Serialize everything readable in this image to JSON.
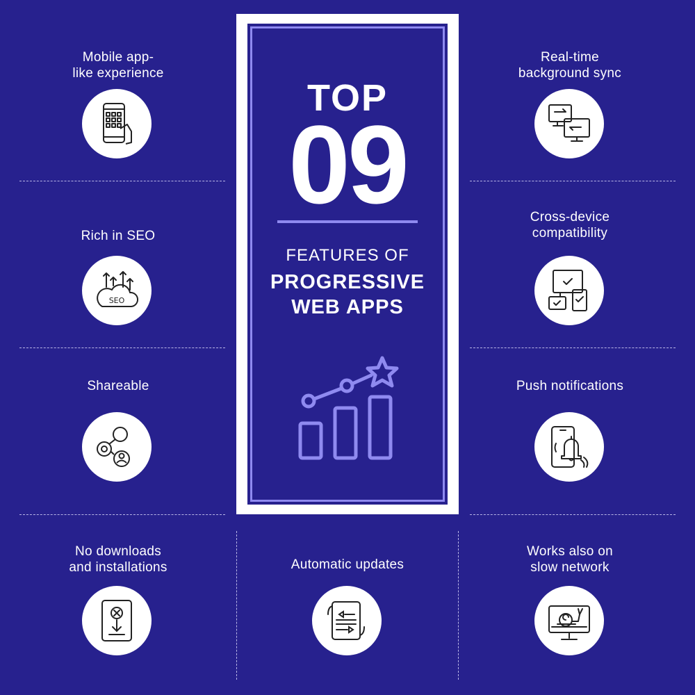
{
  "panel": {
    "top": "TOP",
    "number": "09",
    "line1": "FEATURES OF",
    "line2": "PROGRESSIVE\nWEB APPS",
    "icon": "growth-chart-star-icon"
  },
  "features": {
    "mobile": {
      "label": "Mobile app-\nlike experience",
      "icon": "mobile-touch-icon"
    },
    "seo": {
      "label": "Rich in SEO",
      "icon": "seo-cloud-icon"
    },
    "share": {
      "label": "Shareable",
      "icon": "share-users-icon"
    },
    "nodownload": {
      "label": "No downloads\nand installations",
      "icon": "no-download-icon"
    },
    "updates": {
      "label": "Automatic updates",
      "icon": "auto-update-icon"
    },
    "sync": {
      "label": "Real-time\nbackground sync",
      "icon": "sync-monitors-icon"
    },
    "crossdevice": {
      "label": "Cross-device\ncompatibility",
      "icon": "devices-check-icon"
    },
    "push": {
      "label": "Push notifications",
      "icon": "phone-bell-icon"
    },
    "slow": {
      "label": "Works also on\nslow network",
      "icon": "snail-monitor-icon"
    }
  },
  "colors": {
    "background": "#27218e",
    "accent": "#8f8af0",
    "white": "#ffffff"
  }
}
